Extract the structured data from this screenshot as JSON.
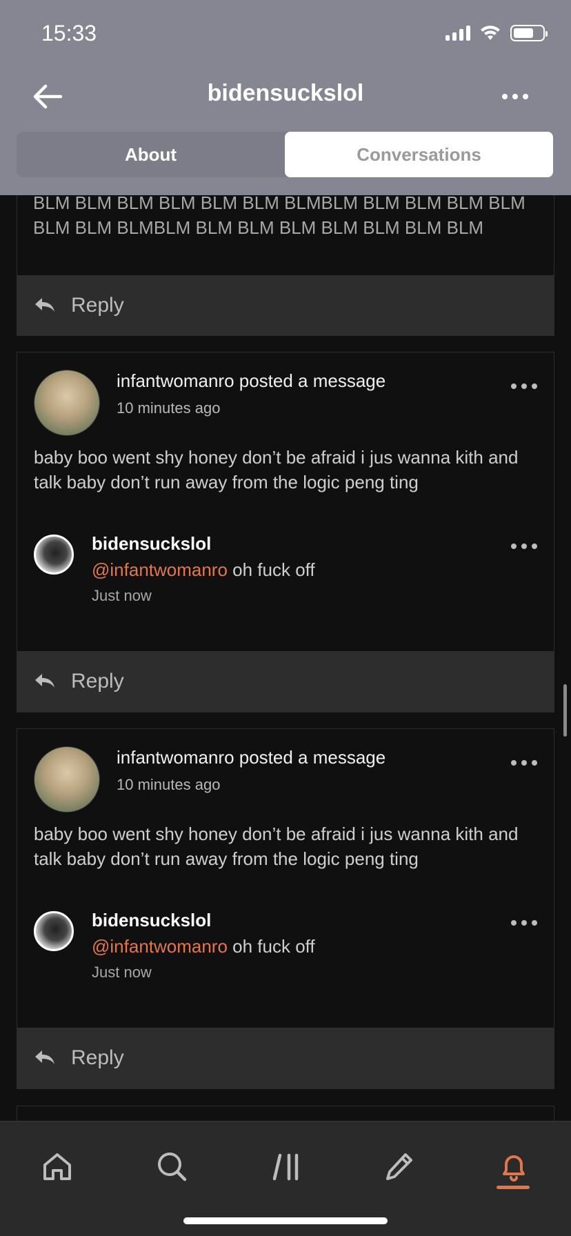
{
  "status_bar": {
    "time": "15:33"
  },
  "header": {
    "title": "bidensuckslol"
  },
  "tabs": [
    {
      "label": "About"
    },
    {
      "label": "Conversations"
    }
  ],
  "top_partial": {
    "text": "BLM BLM BLM BLM BLM BLM BLMBLM BLM BLM BLM BLM BLM BLM BLMBLM BLM BLM BLM BLM BLM BLM BLM",
    "reply_label": "Reply"
  },
  "posts": [
    {
      "poster": "infantwomanro posted a message",
      "time": "10 minutes ago",
      "text": "baby boo went shy honey don’t be afraid i jus wanna kith and talk baby don’t run away from the logic peng ting",
      "reply": {
        "user": "bidensuckslol",
        "mention": "@infantwomanro",
        "text": " oh fuck off",
        "time": "Just now"
      },
      "reply_label": "Reply"
    },
    {
      "poster": "infantwomanro posted a message",
      "time": "10 minutes ago",
      "text": "baby boo went shy honey don’t be afraid i jus wanna kith and talk baby don’t run away from the logic peng ting",
      "reply": {
        "user": "bidensuckslol",
        "mention": "@infantwomanro",
        "text": " oh fuck off",
        "time": "Just now"
      },
      "reply_label": "Reply"
    }
  ],
  "bottom_nav": [
    {
      "icon": "home-icon"
    },
    {
      "icon": "search-icon"
    },
    {
      "icon": "community-icon"
    },
    {
      "icon": "compose-icon"
    },
    {
      "icon": "bell-icon",
      "active": true
    }
  ],
  "colors": {
    "accent": "#e3774a",
    "header": "#868693"
  }
}
